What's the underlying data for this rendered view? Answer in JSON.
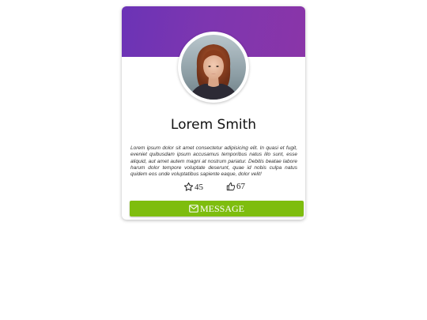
{
  "profile": {
    "name": "Lorem Smith",
    "bio": "Lorem ipsum dolor sit amet consectetur adipisicing elit. In quasi et fugit, eveniet quibusdam ipsum accusamus temporibus natus illo sunt, esse aliquid, aut amet autem magni at nostrum pariatur. Debitis beatae labore harum dolor tempore voluptate deserunt, quae id nobis culpa natus quidem eos unde voluptatibus sapiente eaque, dolor velit!",
    "avatar_icon": "profile-photo"
  },
  "stats": {
    "stars": {
      "icon": "star-outline-icon",
      "count": "45"
    },
    "likes": {
      "icon": "thumbs-up-outline-icon",
      "count": "67"
    }
  },
  "actions": {
    "message_label": "MESSAGE",
    "message_icon": "envelope-icon"
  },
  "colors": {
    "banner_start": "#6b33b6",
    "banner_end": "#8a35a8",
    "button": "#7ebd0e"
  }
}
